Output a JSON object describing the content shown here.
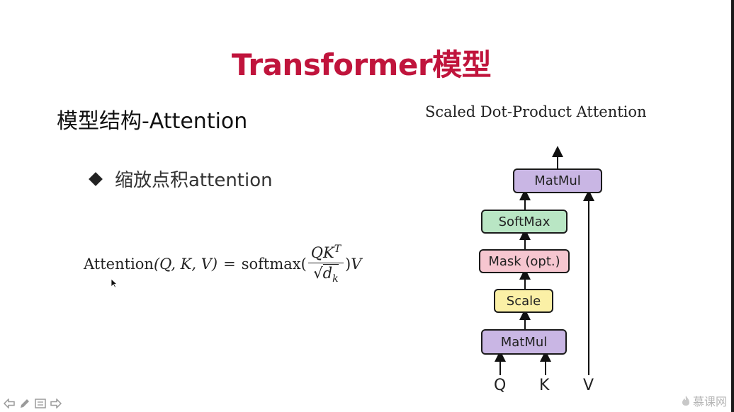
{
  "slide": {
    "title": "Transformer模型",
    "section_heading": "模型结构-Attention",
    "bullet_text": "缩放点积attention"
  },
  "formula": {
    "lhs_name": "Attention",
    "lhs_args": "(Q, K, V)",
    "equals": "=",
    "func": "softmax(",
    "numerator": "QK",
    "numerator_sup": "T",
    "denominator_radicand": "d",
    "denominator_sub": "k",
    "close": ")",
    "tail": "V"
  },
  "diagram": {
    "title": "Scaled Dot-Product Attention",
    "blocks": {
      "matmul_top": "MatMul",
      "softmax": "SoftMax",
      "mask": "Mask (opt.)",
      "scale": "Scale",
      "matmul_bottom": "MatMul"
    },
    "inputs": {
      "q": "Q",
      "k": "K",
      "v": "V"
    },
    "colors": {
      "matmul": "#c9b6e4",
      "softmax": "#b9e6c4",
      "mask": "#f6c6d0",
      "scale": "#fbf0a6"
    }
  },
  "watermark": {
    "text": "慕课网"
  },
  "nav": {
    "icons": [
      "prev-arrow-icon",
      "pen-icon",
      "menu-icon",
      "next-arrow-icon"
    ]
  },
  "theme": {
    "title_color": "#c0143c"
  }
}
